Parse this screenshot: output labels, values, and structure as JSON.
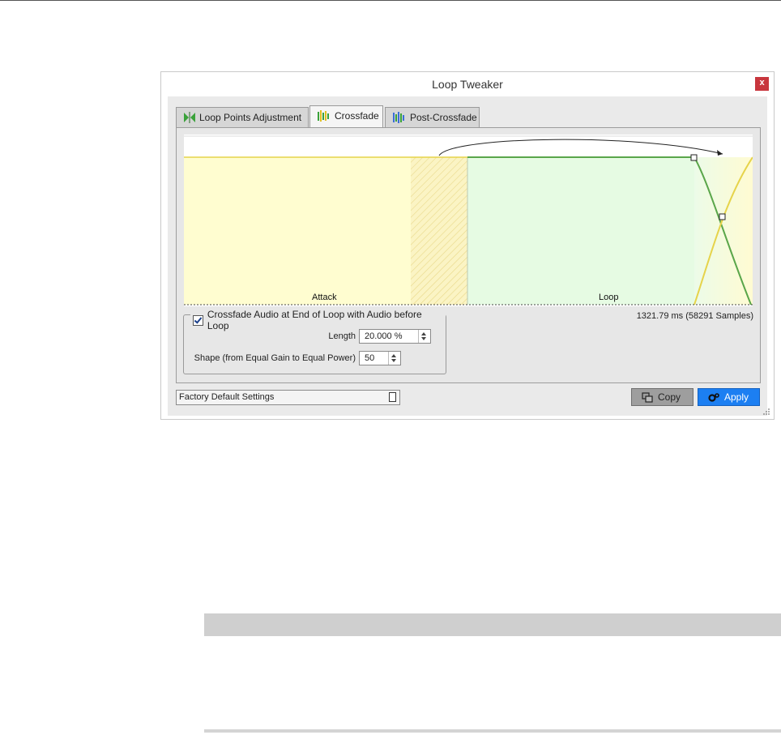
{
  "dialog": {
    "title": "Loop Tweaker",
    "close_label": "x"
  },
  "tabs": [
    {
      "label": "Loop Points Adjustment",
      "icon": "loop-points-icon",
      "active": false
    },
    {
      "label": "Crossfade",
      "icon": "crossfade-icon",
      "active": true
    },
    {
      "label": "Post-Crossfade",
      "icon": "post-crossfade-icon",
      "active": false
    }
  ],
  "graph": {
    "attack_label": "Attack",
    "loop_label": "Loop",
    "info": "1321.79 ms (58291 Samples)",
    "colors": {
      "attack_region": "#fffdd0",
      "loop_region": "#e6fbe3",
      "loop_curve": "#5aa64a",
      "fade_curve": "#e6d34a"
    }
  },
  "options": {
    "crossfade_checkbox_label": "Crossfade Audio at End of Loop with Audio before Loop",
    "crossfade_checked": true,
    "length_label": "Length",
    "length_value": "20.000 %",
    "shape_label": "Shape (from Equal Gain to Equal Power)",
    "shape_value": "50"
  },
  "footer": {
    "preset_value": "Factory Default Settings",
    "copy_label": "Copy",
    "apply_label": "Apply"
  }
}
